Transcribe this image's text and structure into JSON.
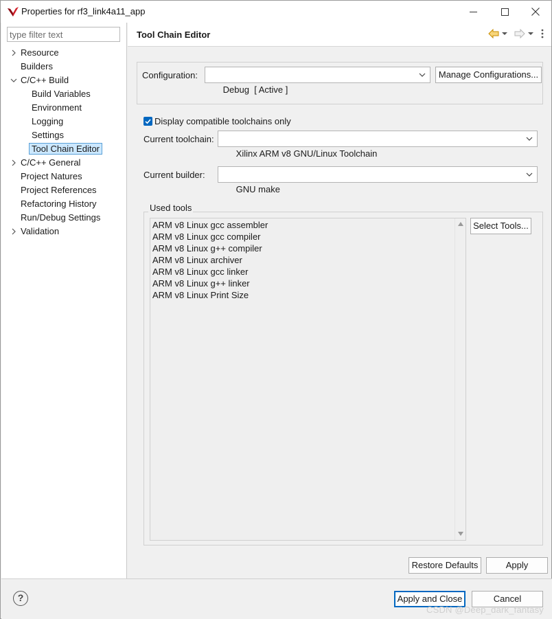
{
  "window": {
    "title": "Properties for rf3_link4a11_app"
  },
  "sidebar": {
    "filter_placeholder": "type filter text",
    "items": [
      {
        "label": "Resource",
        "expandable": true,
        "expanded": false,
        "level": 0
      },
      {
        "label": "Builders",
        "expandable": false,
        "level": 0
      },
      {
        "label": "C/C++ Build",
        "expandable": true,
        "expanded": true,
        "level": 0
      },
      {
        "label": "Build Variables",
        "level": 1
      },
      {
        "label": "Environment",
        "level": 1
      },
      {
        "label": "Logging",
        "level": 1
      },
      {
        "label": "Settings",
        "level": 1
      },
      {
        "label": "Tool Chain Editor",
        "level": 1,
        "selected": true
      },
      {
        "label": "C/C++ General",
        "expandable": true,
        "expanded": false,
        "level": 0
      },
      {
        "label": "Project Natures",
        "level": 0
      },
      {
        "label": "Project References",
        "level": 0
      },
      {
        "label": "Refactoring History",
        "level": 0
      },
      {
        "label": "Run/Debug Settings",
        "level": 0
      },
      {
        "label": "Validation",
        "expandable": true,
        "expanded": false,
        "level": 0
      }
    ]
  },
  "page": {
    "title": "Tool Chain Editor",
    "configuration_label": "Configuration:",
    "configuration_value": "Debug  [ Active ]",
    "manage_configurations": "Manage Configurations...",
    "display_compatible_label": "Display compatible toolchains only",
    "display_compatible_checked": true,
    "current_toolchain_label": "Current toolchain:",
    "current_toolchain_value": "Xilinx ARM v8 GNU/Linux Toolchain",
    "current_builder_label": "Current builder:",
    "current_builder_value": "GNU make",
    "used_tools_label": "Used tools",
    "used_tools": [
      "ARM v8 Linux gcc assembler",
      "ARM v8 Linux gcc compiler",
      "ARM v8 Linux g++ compiler",
      "ARM v8 Linux archiver",
      "ARM v8 Linux gcc linker",
      "ARM v8 Linux g++ linker",
      "ARM v8 Linux Print Size"
    ],
    "select_tools": "Select Tools...",
    "restore_defaults": "Restore Defaults",
    "apply": "Apply"
  },
  "footer": {
    "help": "?",
    "apply_and_close": "Apply and Close",
    "cancel": "Cancel",
    "watermark": "CSDN @Deep_dark_fantasy"
  },
  "colors": {
    "accent": "#0067c0",
    "selection_bg": "#cce8ff",
    "selection_border": "#5aa0d6",
    "back_arrow": "#e3a21a"
  }
}
